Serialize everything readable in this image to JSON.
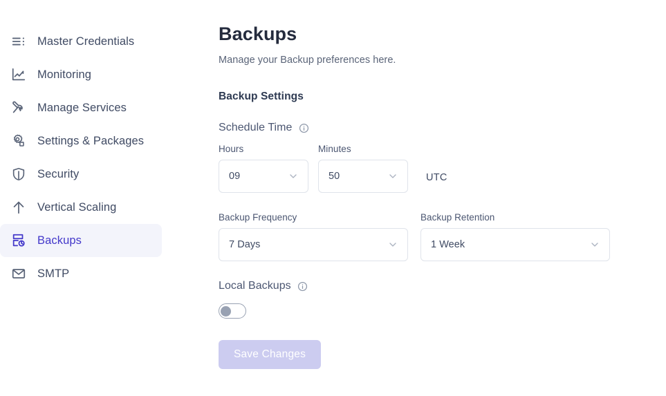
{
  "sidebar": {
    "items": [
      {
        "label": "Master Credentials",
        "icon": "list-menu-icon",
        "active": false
      },
      {
        "label": "Monitoring",
        "icon": "line-chart-icon",
        "active": false
      },
      {
        "label": "Manage Services",
        "icon": "wrench-icon",
        "active": false
      },
      {
        "label": "Settings & Packages",
        "icon": "gear-icon",
        "active": false
      },
      {
        "label": "Security",
        "icon": "shield-icon",
        "active": false
      },
      {
        "label": "Vertical Scaling",
        "icon": "up-arrow-icon",
        "active": false
      },
      {
        "label": "Backups",
        "icon": "server-refresh-icon",
        "active": true
      },
      {
        "label": "SMTP",
        "icon": "envelope-icon",
        "active": false
      }
    ]
  },
  "main": {
    "title": "Backups",
    "subtitle": "Manage your Backup preferences here.",
    "section_title": "Backup Settings",
    "schedule_time": {
      "label": "Schedule Time",
      "hours_label": "Hours",
      "hours_value": "09",
      "minutes_label": "Minutes",
      "minutes_value": "50",
      "timezone": "UTC"
    },
    "backup_frequency": {
      "label": "Backup Frequency",
      "value": "7 Days"
    },
    "backup_retention": {
      "label": "Backup Retention",
      "value": "1 Week"
    },
    "local_backups": {
      "label": "Local Backups",
      "enabled": false
    },
    "save_label": "Save Changes"
  },
  "colors": {
    "accent": "#4338ca",
    "active_bg": "#f3f4fb",
    "text": "#3f4a63",
    "muted": "#5a6478",
    "border": "#dfe3ea",
    "button_disabled": "#ccccf0"
  }
}
